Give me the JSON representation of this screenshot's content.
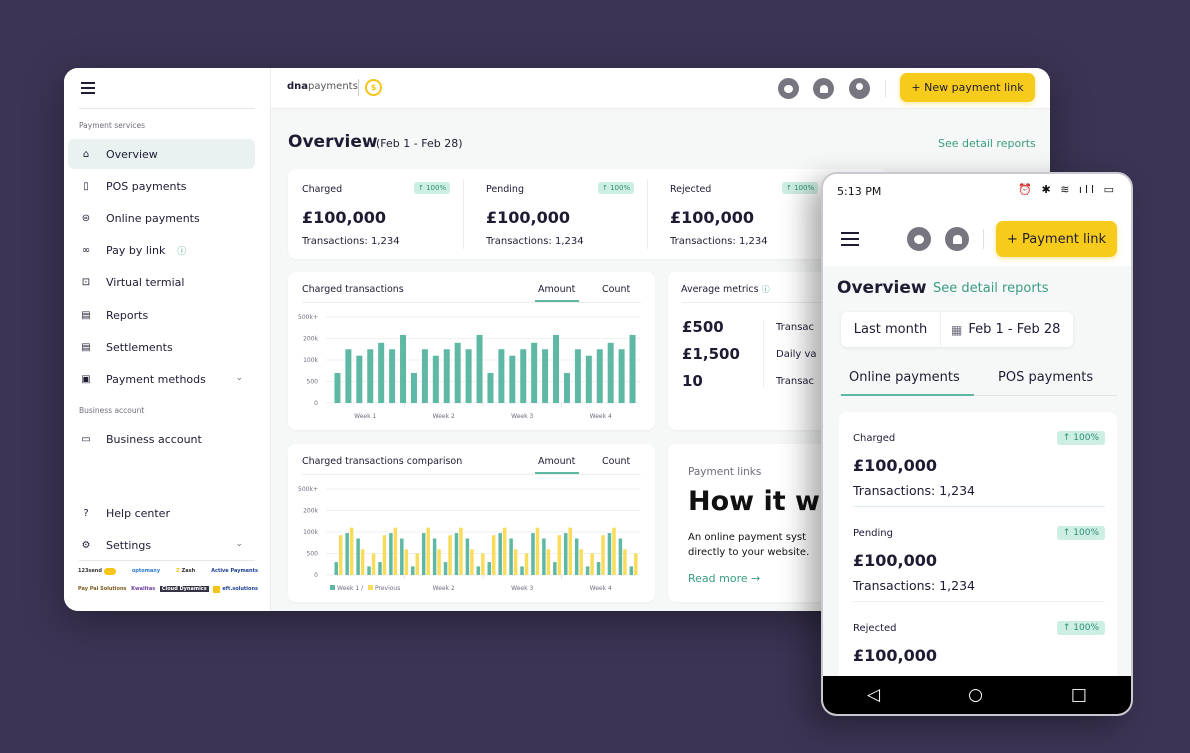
{
  "desktop": {
    "sidebar": {
      "sections": [
        "Payment services",
        "Business account"
      ],
      "items": [
        {
          "label": "Overview",
          "icon": "home-icon",
          "active": true
        },
        {
          "label": "POS payments",
          "icon": "pos-terminal-icon"
        },
        {
          "label": "Online payments",
          "icon": "online-payments-icon"
        },
        {
          "label": "Pay by link",
          "icon": "link-icon",
          "info": "info-icon"
        },
        {
          "label": "Virtual termial",
          "icon": "terminal-icon"
        },
        {
          "label": "Reports",
          "icon": "report-icon"
        },
        {
          "label": "Settlements",
          "icon": "document-icon"
        },
        {
          "label": "Payment methods",
          "icon": "wallet-icon",
          "expandable": true
        },
        {
          "label": "Business account",
          "icon": "business-icon"
        },
        {
          "label": "Help center",
          "icon": "question-icon"
        },
        {
          "label": "Settings",
          "icon": "gear-icon",
          "expandable": true
        }
      ],
      "partner_logos": [
        "123send",
        "optomany",
        "Zash",
        "Active Payments",
        "Pay Pal Solutions",
        "Kwalitas",
        "Cloud Dynamics",
        "eft.solutions"
      ]
    },
    "header": {
      "brand_bold": "dna",
      "brand_light": "payments",
      "new_link_button": "+ New payment link"
    },
    "page": {
      "title": "Overview",
      "range": "(Feb 1 - Feb 28)",
      "detail_link": "See detail reports"
    },
    "stats": [
      {
        "label": "Charged",
        "badge": "↑ 100%",
        "value": "£100,000",
        "transactions": "Transactions: 1,234"
      },
      {
        "label": "Pending",
        "badge": "↑ 100%",
        "value": "£100,000",
        "transactions": "Transactions: 1,234"
      },
      {
        "label": "Rejected",
        "badge": "↑ 100%",
        "value": "£100,000",
        "transactions": "Transactions: 1,234"
      }
    ],
    "charged_card": {
      "title": "Charged transactions",
      "tab_amount": "Amount",
      "tab_count": "Count"
    },
    "comparison_card": {
      "title": "Charged transactions comparison",
      "tab_amount": "Amount",
      "tab_count": "Count"
    },
    "average_metrics": {
      "title": "Average metrics",
      "values": [
        "£500",
        "£1,500",
        "10"
      ],
      "descriptions": [
        "Transac",
        "Daily va",
        "Transac"
      ]
    },
    "payment_links": {
      "kicker": "Payment links",
      "heading": "How it wo",
      "body_line1": "An online payment syst",
      "body_line2": "directly to your website.",
      "read_more": "Read more"
    }
  },
  "phone": {
    "status_time": "5:13 PM",
    "status_icons": "⏰ ✱ ≋ ıll ▭",
    "payment_link_button": "+ Payment link",
    "title": "Overview",
    "detail_link": "See detail reports",
    "range_preset": "Last month",
    "range_dates": "Feb 1 - Feb 28",
    "tabs": [
      "Online payments",
      "POS payments"
    ],
    "active_tab": "Online payments",
    "stats": [
      {
        "label": "Charged",
        "badge": "↑ 100%",
        "value": "£100,000",
        "transactions": "Transactions: 1,234"
      },
      {
        "label": "Pending",
        "badge": "↑ 100%",
        "value": "£100,000",
        "transactions": "Transactions: 1,234"
      },
      {
        "label": "Rejected",
        "badge": "↑ 100%",
        "value": "£100,000",
        "transactions": ""
      }
    ],
    "nav": [
      "◁",
      "○",
      "□"
    ]
  },
  "colors": {
    "accent": "#5fb8a3",
    "accent_text": "#3a9c83",
    "primary_button": "#f7cb1b",
    "previous_series": "#f9dc5c",
    "background": "#3b3454"
  },
  "chart_data": [
    {
      "type": "bar",
      "title": "Charged transactions",
      "xlabel": "",
      "ylabel": "",
      "y_ticks": [
        "0",
        "500",
        "100k",
        "200k",
        "500k+"
      ],
      "y_tick_values": [
        0,
        500,
        100000,
        200000,
        500000
      ],
      "categories": [
        "Week 1",
        "Week 2",
        "Week 3",
        "Week 4"
      ],
      "bars_per_category": 7,
      "series": [
        {
          "name": "Amount",
          "values": [
            40000,
            150000,
            120000,
            150000,
            180000,
            150000,
            250000,
            40000,
            150000,
            120000,
            150000,
            180000,
            150000,
            250000,
            40000,
            150000,
            120000,
            150000,
            180000,
            150000,
            250000,
            40000,
            150000,
            120000,
            150000,
            180000,
            150000,
            250000
          ]
        }
      ],
      "grid": true
    },
    {
      "type": "bar",
      "title": "Charged transactions comparison",
      "xlabel": "",
      "ylabel": "",
      "y_ticks": [
        "0",
        "500",
        "100k",
        "200k",
        "500k+"
      ],
      "y_tick_values": [
        0,
        500,
        100000,
        200000,
        500000
      ],
      "categories": [
        "Week 1",
        "Week 2",
        "Week 3",
        "Week 4"
      ],
      "bars_per_category": 7,
      "legend": [
        "Week 1",
        "Previous"
      ],
      "legend_position": "bottom-left",
      "series": [
        {
          "name": "Week 1",
          "values": [
            300,
            95000,
            70000,
            200,
            300,
            95000,
            70000,
            200,
            95000,
            70000,
            300,
            95000,
            70000,
            200,
            300,
            95000,
            70000,
            200,
            95000,
            70000,
            300,
            95000,
            70000,
            200,
            300,
            95000,
            70000,
            200
          ]
        },
        {
          "name": "Previous",
          "values": [
            85000,
            120000,
            20000,
            1000,
            85000,
            120000,
            20000,
            1000,
            120000,
            20000,
            85000,
            120000,
            20000,
            1000,
            85000,
            120000,
            20000,
            1000,
            120000,
            20000,
            85000,
            120000,
            20000,
            1000,
            85000,
            120000,
            20000,
            1000
          ]
        }
      ],
      "grid": true
    }
  ]
}
